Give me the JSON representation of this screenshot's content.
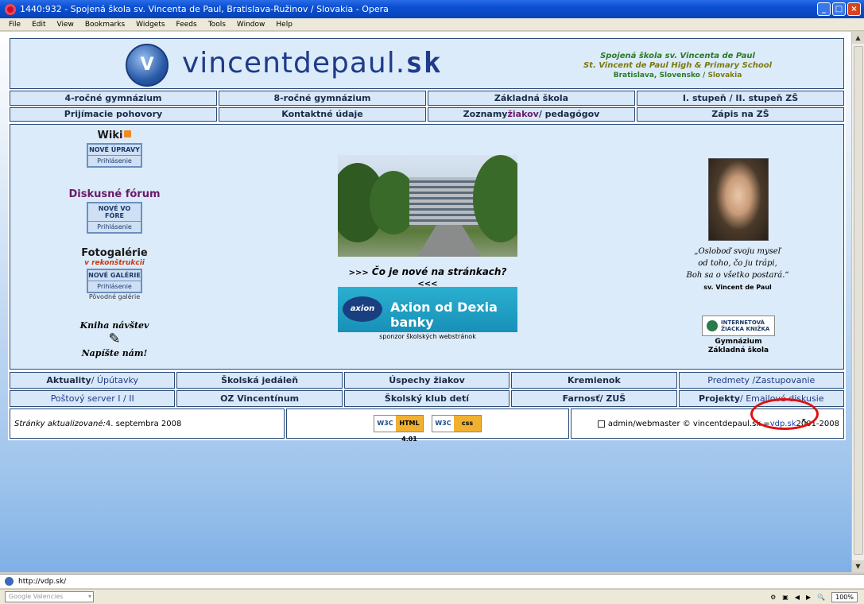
{
  "window": {
    "title": "1440:932 - Spojená škola sv. Vincenta de Paul, Bratislava-Ružinov / Slovakia - Opera",
    "buttons": [
      "_",
      "□",
      "×"
    ]
  },
  "menu": [
    "File",
    "Edit",
    "View",
    "Bookmarks",
    "Widgets",
    "Feeds",
    "Tools",
    "Window",
    "Help"
  ],
  "header": {
    "logo_text": "V",
    "site_name": "vincentdepaul.",
    "site_tld": "sk",
    "school_line1": "Spojená škola sv. Vincenta de Paul",
    "school_line2": "St. Vincent de Paul High & Primary School",
    "school_line3": "Bratislava, Slovensko /",
    "school_line3b": " Slovakia"
  },
  "top_nav": [
    "4-ročné gymnázium",
    "8-ročné gymnázium",
    "Základná škola",
    "I. stupeň / II. stupeň ZŠ",
    "Prijímacie pohovory",
    "Kontaktné údaje",
    "Zoznamy ",
    "Zápis na ZŠ"
  ],
  "top_nav_extra": {
    "students": "žiakov",
    "teachers": " / pedagógov"
  },
  "left": {
    "wiki_title": "Wiki",
    "wiki_btn_a": "NOVÉ ÚPRAVY",
    "wiki_btn_b": "Prihlásenie",
    "forum_title": "Diskusné fórum",
    "forum_btn_a": "NOVÉ VO FÓRE",
    "forum_btn_b": "Prihlásenie",
    "gallery_title": "Fotogalérie",
    "gallery_note": "v rekonštrukcii",
    "gallery_btn_a": "NOVÉ GALÉRIE",
    "gallery_btn_b": "Prihlásenie",
    "gallery_old": "Pôvodné galérie",
    "guestbook_title": "Kniha návštev",
    "guestbook_sub": "Napíšte nám!"
  },
  "center": {
    "whats_new_l": ">>>",
    "whats_new": "Čo je nové na stránkach?",
    "whats_new_r": "<<<",
    "banner_logo": "axion",
    "banner_text": "Axion od Dexia banky",
    "sponsor": "sponzor školských webstránok"
  },
  "right": {
    "quote_l1": "„Osloboď svoju myseľ",
    "quote_l2": "od toho, čo ju trápi,",
    "quote_l3": "Boh sa o všetko postará.“",
    "quote_sign": "sv. Vincent de Paul",
    "ezk_text": "INTERNETOVÁ ŽIACKA KNIŽKA",
    "ezk_link1": "Gymnázium",
    "ezk_link2": "Základná škola"
  },
  "bottom_nav": {
    "r1": [
      "Aktuality",
      " / Úpútavky",
      "Školská jedáleň",
      "Úspechy žiakov",
      "Kremienok",
      "Predmety / ",
      "Zastupovanie"
    ],
    "r2": [
      "Poštový server I / II",
      "OZ Vincentínum",
      "Školský klub detí",
      "Farnosť",
      " / ZUŠ",
      "Projekty",
      " / Emailové diskusie"
    ]
  },
  "footer": {
    "updated_label": "Stránky aktualizované:",
    "updated_value": " 4. septembra 2008",
    "w3c_html_w": "W3C",
    "w3c_html_v": "HTML 4.01",
    "w3c_css_w": "W3C",
    "w3c_css_v": "css",
    "admin": "admin/webmaster © vincentdepaul.sk = ",
    "admin_link": "vdp.sk",
    "years": " 2001-2008"
  },
  "address": "http://vdp.sk/",
  "status": {
    "search_placeholder": "Google Valencies",
    "zoom": "100%"
  },
  "colors": {
    "accent_blue": "#1f3b8a",
    "panel": "#dcebf9",
    "highlight_circle": "#e01010"
  }
}
